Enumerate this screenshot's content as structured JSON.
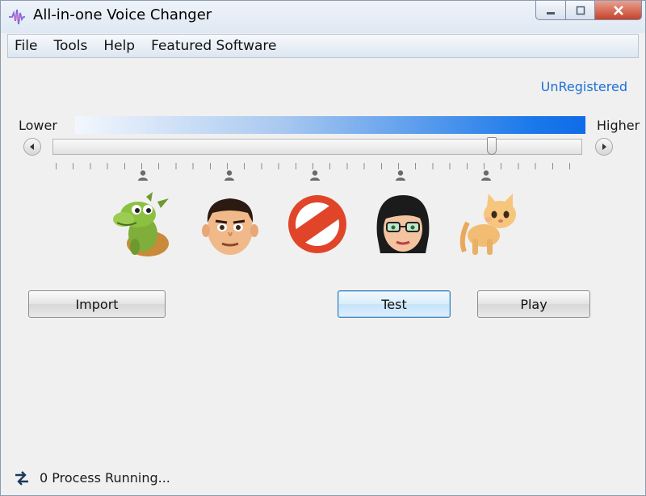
{
  "window": {
    "title": "All-in-one Voice Changer"
  },
  "menu": {
    "items": [
      {
        "label": "File"
      },
      {
        "label": "Tools"
      },
      {
        "label": "Help"
      },
      {
        "label": "Featured Software"
      }
    ]
  },
  "registration": {
    "status": "UnRegistered"
  },
  "pitch": {
    "lower_label": "Lower",
    "higher_label": "Higher",
    "value_fraction": 0.83
  },
  "voices": [
    {
      "name": "dragon",
      "icon": "dragon-icon"
    },
    {
      "name": "man",
      "icon": "man-face-icon"
    },
    {
      "name": "none",
      "icon": "no-entry-icon"
    },
    {
      "name": "woman",
      "icon": "woman-face-icon"
    },
    {
      "name": "cat",
      "icon": "cat-icon"
    }
  ],
  "buttons": {
    "import_label": "Import",
    "test_label": "Test",
    "play_label": "Play"
  },
  "status": {
    "text": "0 Process Running..."
  },
  "colors": {
    "accent": "#1f6fd4",
    "bar_end": "#0f6ce8",
    "no_entry": "#e0452a"
  }
}
